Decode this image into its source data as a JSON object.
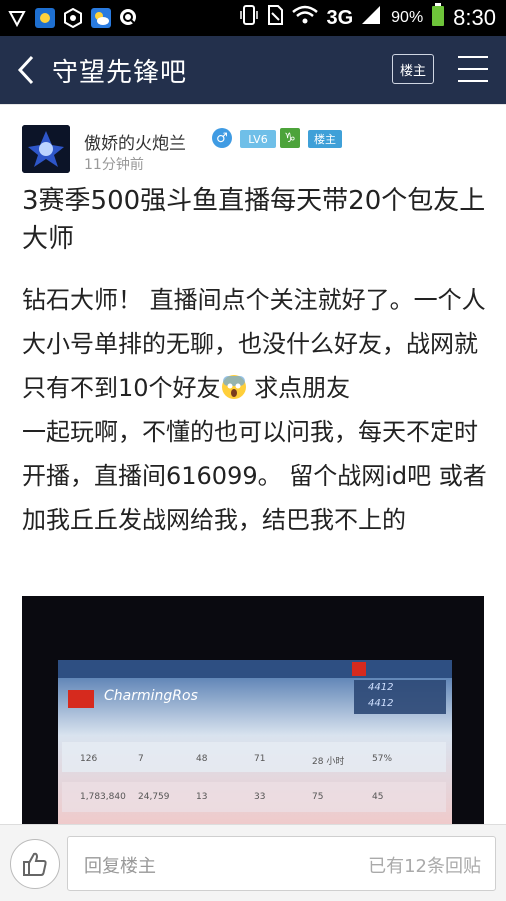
{
  "status_bar": {
    "network": "3G",
    "signal_suffix": "2",
    "battery": "90%",
    "time": "8:30"
  },
  "nav": {
    "title": "守望先锋吧",
    "owner_button": "楼主"
  },
  "post": {
    "author": "傲娇的火炮兰",
    "level_badge": "LV6",
    "owner_badge": "楼主",
    "time": "11分钟前",
    "title": "3赛季500强斗鱼直播每天带20个包友上大师",
    "body_line1": "钻石大师！ 直播间点个关注就好了。一个人大小号单排的无聊，也没什么好友，战网就只有不到10个好友",
    "body_line2": " 求点朋友",
    "body_line3": "一起玩啊，不懂的也可以问我，每天不定时开播，直播间616099。 留个战网id吧 或者加我丘丘发战网给我，结巴我不上的",
    "image": {
      "player_name": "CharmingRos",
      "stats_row1": [
        "126",
        "7",
        "48",
        "71",
        "28 小时",
        "57%"
      ],
      "stats_row2": [
        "1,783,840",
        "24,759",
        "13",
        "33",
        "75",
        "45"
      ],
      "sr_values": [
        "4412",
        "4412"
      ]
    }
  },
  "reply_bar": {
    "placeholder": "回复楼主",
    "count_text": "已有12条回贴"
  },
  "colors": {
    "nav_bg": "#23304c",
    "badge_blue": "#3fa0d8"
  }
}
